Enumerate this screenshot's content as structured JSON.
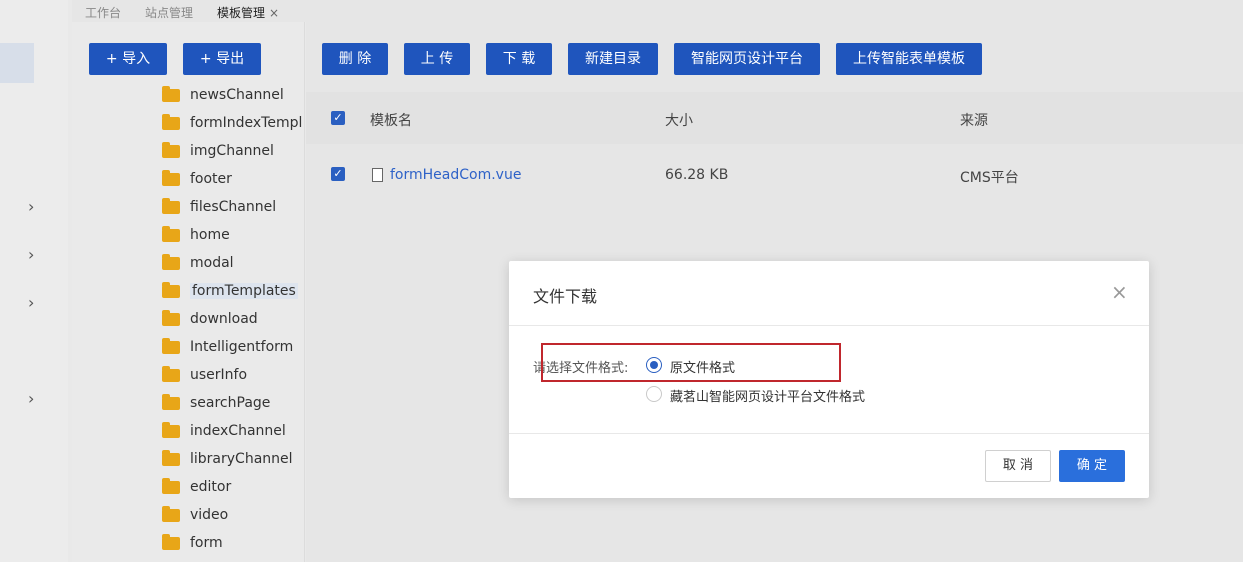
{
  "tabs": [
    {
      "label": "工作台"
    },
    {
      "label": "站点管理"
    },
    {
      "label": "模板管理",
      "close": "×"
    }
  ],
  "tree_buttons": {
    "import": "+ 导入",
    "export": "+ 导出"
  },
  "toolbar": {
    "delete": "删 除",
    "upload": "上 传",
    "download": "下 载",
    "new_dir": "新建目录",
    "smart_platform": "智能网页设计平台",
    "upload_form_template": "上传智能表单模板"
  },
  "folders": [
    {
      "label": "newsChannel"
    },
    {
      "label": "formIndexTempl"
    },
    {
      "label": "imgChannel"
    },
    {
      "label": "footer"
    },
    {
      "label": "filesChannel"
    },
    {
      "label": "home"
    },
    {
      "label": "modal"
    },
    {
      "label": "formTemplates"
    },
    {
      "label": "download"
    },
    {
      "label": "Intelligentform"
    },
    {
      "label": "userInfo"
    },
    {
      "label": "searchPage"
    },
    {
      "label": "indexChannel"
    },
    {
      "label": "libraryChannel"
    },
    {
      "label": "editor"
    },
    {
      "label": "video"
    },
    {
      "label": "form"
    }
  ],
  "table": {
    "headers": {
      "name": "模板名",
      "size": "大小",
      "source": "来源"
    },
    "rows": [
      {
        "name": "formHeadCom.vue",
        "size": "66.28 KB",
        "source": "CMS平台"
      }
    ]
  },
  "modal": {
    "title": "文件下载",
    "close": "×",
    "label": "请选择文件格式:",
    "options": [
      {
        "label": "原文件格式",
        "selected": true
      },
      {
        "label": "藏茗山智能网页设计平台文件格式",
        "selected": false
      }
    ],
    "cancel": "取 消",
    "ok": "确 定"
  },
  "colors": {
    "primary": "#1f55bd",
    "ok_button": "#2a6fdc",
    "highlight_box": "#c0272d",
    "folder": "#e8a618"
  }
}
